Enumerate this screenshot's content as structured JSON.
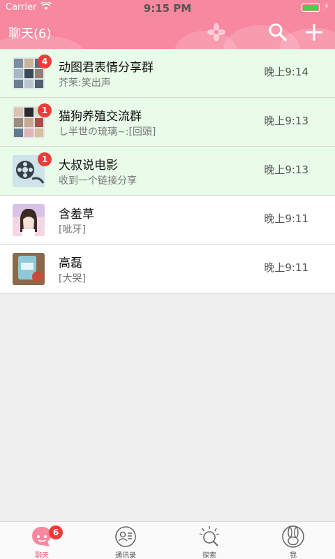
{
  "status_bar": {
    "carrier": "Carrier",
    "time": "9:15 PM"
  },
  "header": {
    "title": "聊天(6)"
  },
  "chats": [
    {
      "name": "动图君表情分享群",
      "preview": "芥茉:笑出声",
      "time": "晚上9:14",
      "badge": "4"
    },
    {
      "name": "猫狗养殖交流群",
      "preview": "し半世の琉璃~:[回頭]",
      "time": "晚上9:13",
      "badge": "1"
    },
    {
      "name": "大叔说电影",
      "preview": "收到一个链接分享",
      "time": "晚上9:13",
      "badge": "1"
    },
    {
      "name": "含羞草",
      "preview": "[呲牙]",
      "time": "晚上9:11"
    },
    {
      "name": "高磊",
      "preview": "[大哭]",
      "time": "晚上9:11"
    }
  ],
  "tabs": [
    {
      "label": "聊天",
      "icon": "chat-bubble-icon",
      "badge": "6"
    },
    {
      "label": "通讯录",
      "icon": "contacts-icon"
    },
    {
      "label": "探索",
      "icon": "explore-icon"
    },
    {
      "label": "我",
      "icon": "rabbit-profile-icon"
    }
  ],
  "colors": {
    "header": "#f7889f",
    "unread_row": "#e9fbe9",
    "badge": "#f23a3a",
    "active_tab": "#ef5a78"
  }
}
